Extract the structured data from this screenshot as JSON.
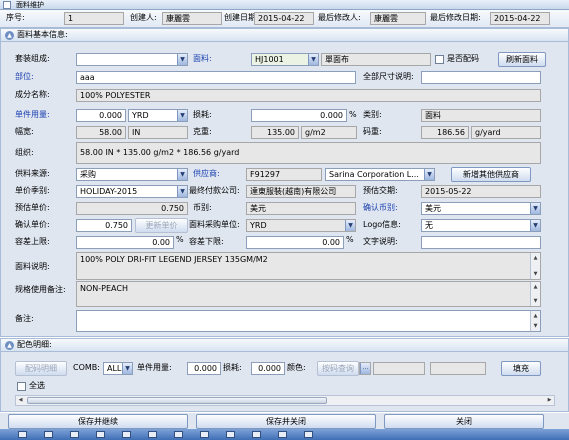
{
  "window": {
    "title": "面料维护"
  },
  "header": {
    "seq_label": "序号:",
    "seq_value": "1",
    "creator_label": "创建人:",
    "creator_value": "康麗雲",
    "created_date_label": "创建日期:",
    "created_date_value": "2015-04-22",
    "modifier_label": "最后修改人:",
    "modifier_value": "康麗雲",
    "modified_date_label": "最后修改日期:",
    "modified_date_value": "2015-04-22"
  },
  "basic": {
    "section_title": "面料基本信息:",
    "set_label": "套装组成:",
    "set_value": "",
    "fabric_label": "面料:",
    "fabric_code": "HJ1001",
    "fabric_name": "單面布",
    "is_match_label": "是否配码",
    "refresh_button": "刷新面料",
    "part_label": "部位:",
    "part_value": "aaa",
    "allsize_label": "全部尺寸说明:",
    "allsize_value": "",
    "composition_label": "成分名称:",
    "composition_value": "100% POLYESTER",
    "unit_usage_label": "单件用量:",
    "unit_usage_value": "0.000",
    "unit_usage_unit": "YRD",
    "loss_label": "损耗:",
    "loss_value": "0.000",
    "loss_unit": "%",
    "category_label": "类别:",
    "category_value": "面料",
    "width_label": "幅宽:",
    "width_value": "58.00",
    "width_unit": "IN",
    "weight_label": "克重:",
    "weight_value": "135.00",
    "weight_unit": "g/m2",
    "yardweight_label": "码重:",
    "yardweight_value": "186.56",
    "yardweight_unit": "g/yard",
    "structure_label": "组织:",
    "structure_value": "58.00 IN * 135.00 g/m2 * 186.56 g/yard",
    "supply_source_label": "供料来源:",
    "supply_source_value": "采购",
    "supplier_label": "供应商:",
    "supplier_code": "F91297",
    "supplier_name": "Sarina Corporation L...",
    "add_supplier_button": "新增其他供应商",
    "price_season_label": "单价季别:",
    "price_season_value": "HOLIDAY-2015",
    "final_pay_label": "最终付款公司:",
    "final_pay_value": "達東服裝(越南)有限公司",
    "est_delivery_label": "预估交期:",
    "est_delivery_value": "2015-05-22",
    "est_price_label": "预估单价:",
    "est_price_value": "0.750",
    "currency_label": "币别:",
    "currency_value": "美元",
    "confirm_currency_label": "确认币别:",
    "confirm_currency_value": "美元",
    "confirm_price_label": "确认单价:",
    "confirm_price_value": "0.750",
    "update_price_button": "更新单价",
    "purchase_unit_label": "面料采购单位:",
    "purchase_unit_value": "YRD",
    "logo_label": "Logo信息:",
    "logo_value": "无",
    "tol_upper_label": "容差上限:",
    "tol_upper_value": "0.00",
    "tol_upper_unit": "%",
    "tol_lower_label": "容差下限:",
    "tol_lower_value": "0.00",
    "tol_lower_unit": "%",
    "text_desc_label": "文字说明:",
    "text_desc_value": "",
    "fabric_desc_label": "面料说明:",
    "fabric_desc_value": "100% POLY DRI-FIT LEGEND JERSEY 135GM/M2",
    "spec_note_label": "规格使用备注:",
    "spec_note_value": "NON-PEACH",
    "remark_label": "备注:",
    "remark_value": ""
  },
  "color": {
    "section_title": "配色明细:",
    "detail_button": "配码明细",
    "comb_label": "COMB:",
    "comb_value": "ALL",
    "unit_usage_label": "单件用量:",
    "unit_usage_value": "0.000",
    "loss_label": "损耗:",
    "loss_value": "0.000",
    "color_label": "颜色:",
    "color_search_button": "按码查询",
    "fill_button": "填充",
    "select_all_label": "全选"
  },
  "footer": {
    "save_continue": "保存并继续",
    "save_close": "保存并关闭",
    "close": "关闭"
  }
}
